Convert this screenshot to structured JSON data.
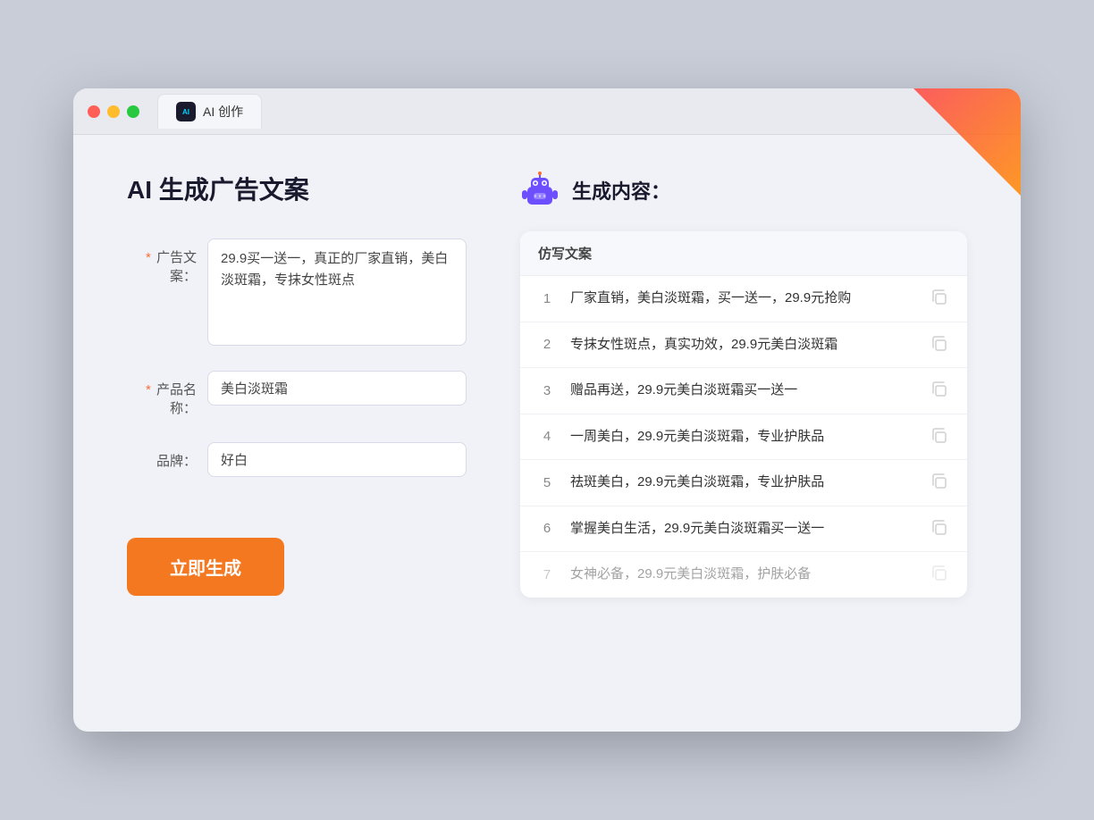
{
  "window": {
    "tab_label": "AI 创作"
  },
  "left_panel": {
    "title": "AI 生成广告文案",
    "fields": [
      {
        "id": "ad-copy",
        "label": "广告文案：",
        "required": true,
        "type": "textarea",
        "value": "29.9买一送一，真正的厂家直销，美白淡斑霜，专抹女性斑点"
      },
      {
        "id": "product-name",
        "label": "产品名称：",
        "required": true,
        "type": "input",
        "value": "美白淡斑霜"
      },
      {
        "id": "brand",
        "label": "品牌：",
        "required": false,
        "type": "input",
        "value": "好白"
      }
    ],
    "button_label": "立即生成"
  },
  "right_panel": {
    "title": "生成内容：",
    "column_header": "仿写文案",
    "items": [
      {
        "num": "1",
        "text": "厂家直销，美白淡斑霜，买一送一，29.9元抢购",
        "faded": false
      },
      {
        "num": "2",
        "text": "专抹女性斑点，真实功效，29.9元美白淡斑霜",
        "faded": false
      },
      {
        "num": "3",
        "text": "赠品再送，29.9元美白淡斑霜买一送一",
        "faded": false
      },
      {
        "num": "4",
        "text": "一周美白，29.9元美白淡斑霜，专业护肤品",
        "faded": false
      },
      {
        "num": "5",
        "text": "祛斑美白，29.9元美白淡斑霜，专业护肤品",
        "faded": false
      },
      {
        "num": "6",
        "text": "掌握美白生活，29.9元美白淡斑霜买一送一",
        "faded": false
      },
      {
        "num": "7",
        "text": "女神必备，29.9元美白淡斑霜，护肤必备",
        "faded": true
      }
    ]
  },
  "colors": {
    "accent_orange": "#f47820",
    "required_star": "#ff6b35",
    "robot_purple": "#6e4fff"
  }
}
